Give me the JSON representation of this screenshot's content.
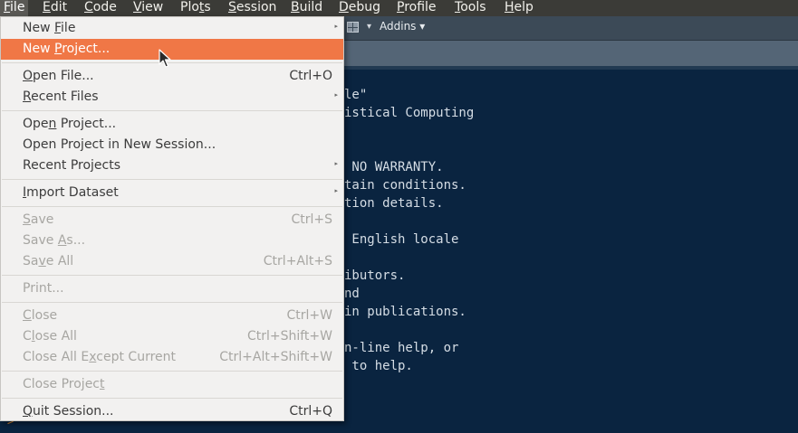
{
  "menubar": {
    "items": [
      {
        "pre": "",
        "ul": "F",
        "post": "ile"
      },
      {
        "pre": "",
        "ul": "E",
        "post": "dit"
      },
      {
        "pre": "",
        "ul": "C",
        "post": "ode"
      },
      {
        "pre": "",
        "ul": "V",
        "post": "iew"
      },
      {
        "pre": "Plo",
        "ul": "t",
        "post": "s"
      },
      {
        "pre": "",
        "ul": "S",
        "post": "ession"
      },
      {
        "pre": "",
        "ul": "B",
        "post": "uild"
      },
      {
        "pre": "",
        "ul": "D",
        "post": "ebug"
      },
      {
        "pre": "",
        "ul": "P",
        "post": "rofile"
      },
      {
        "pre": "",
        "ul": "T",
        "post": "ools"
      },
      {
        "pre": "",
        "ul": "H",
        "post": "elp"
      }
    ]
  },
  "toolbar": {
    "addins_label": "Addins",
    "addins_arrow": "▾",
    "grid_arrow": "▾"
  },
  "file_menu": {
    "new_file": {
      "pre": "New ",
      "ul": "F",
      "post": "ile"
    },
    "new_project": {
      "pre": "New ",
      "ul": "P",
      "post": "roject..."
    },
    "open_file": {
      "pre": "",
      "ul": "O",
      "post": "pen File...",
      "shortcut": "Ctrl+O"
    },
    "recent_files": {
      "pre": "",
      "ul": "R",
      "post": "ecent Files"
    },
    "open_project": {
      "pre": "Ope",
      "ul": "n",
      "post": " Project..."
    },
    "open_project_new_session": {
      "text": "Open Project in New Session..."
    },
    "recent_projects": {
      "text": "Recent Projects"
    },
    "import_dataset": {
      "pre": "",
      "ul": "I",
      "post": "mport Dataset"
    },
    "save": {
      "pre": "",
      "ul": "S",
      "post": "ave",
      "shortcut": "Ctrl+S"
    },
    "save_as": {
      "pre": "Save ",
      "ul": "A",
      "post": "s..."
    },
    "save_all": {
      "pre": "Sa",
      "ul": "v",
      "post": "e All",
      "shortcut": "Ctrl+Alt+S"
    },
    "print": {
      "pre": "Print",
      "ul": "",
      "post": "..."
    },
    "close": {
      "pre": "",
      "ul": "C",
      "post": "lose",
      "shortcut": "Ctrl+W"
    },
    "close_all": {
      "pre": "C",
      "ul": "l",
      "post": "ose All",
      "shortcut": "Ctrl+Shift+W"
    },
    "close_all_except": {
      "pre": "Close All E",
      "ul": "x",
      "post": "cept Current",
      "shortcut": "Ctrl+Alt+Shift+W"
    },
    "close_project": {
      "pre": "Close Projec",
      "ul": "t",
      "post": ""
    },
    "quit_session": {
      "pre": "",
      "ul": "Q",
      "post": "uit Session...",
      "shortcut": "Ctrl+Q"
    },
    "submenu_arrow": "▸"
  },
  "console": {
    "lines": [
      "le\"",
      "istical Computing",
      "",
      "",
      " NO WARRANTY.",
      "tain conditions.",
      "tion details.",
      "",
      " English locale",
      "",
      "ibutors.",
      "nd",
      "in publications.",
      "",
      "n-line help, or",
      " to help."
    ],
    "prompt": ">"
  },
  "colors": {
    "highlight": "#f07746",
    "console_bg": "#0a2440",
    "menubar_bg": "#3b3b37"
  }
}
